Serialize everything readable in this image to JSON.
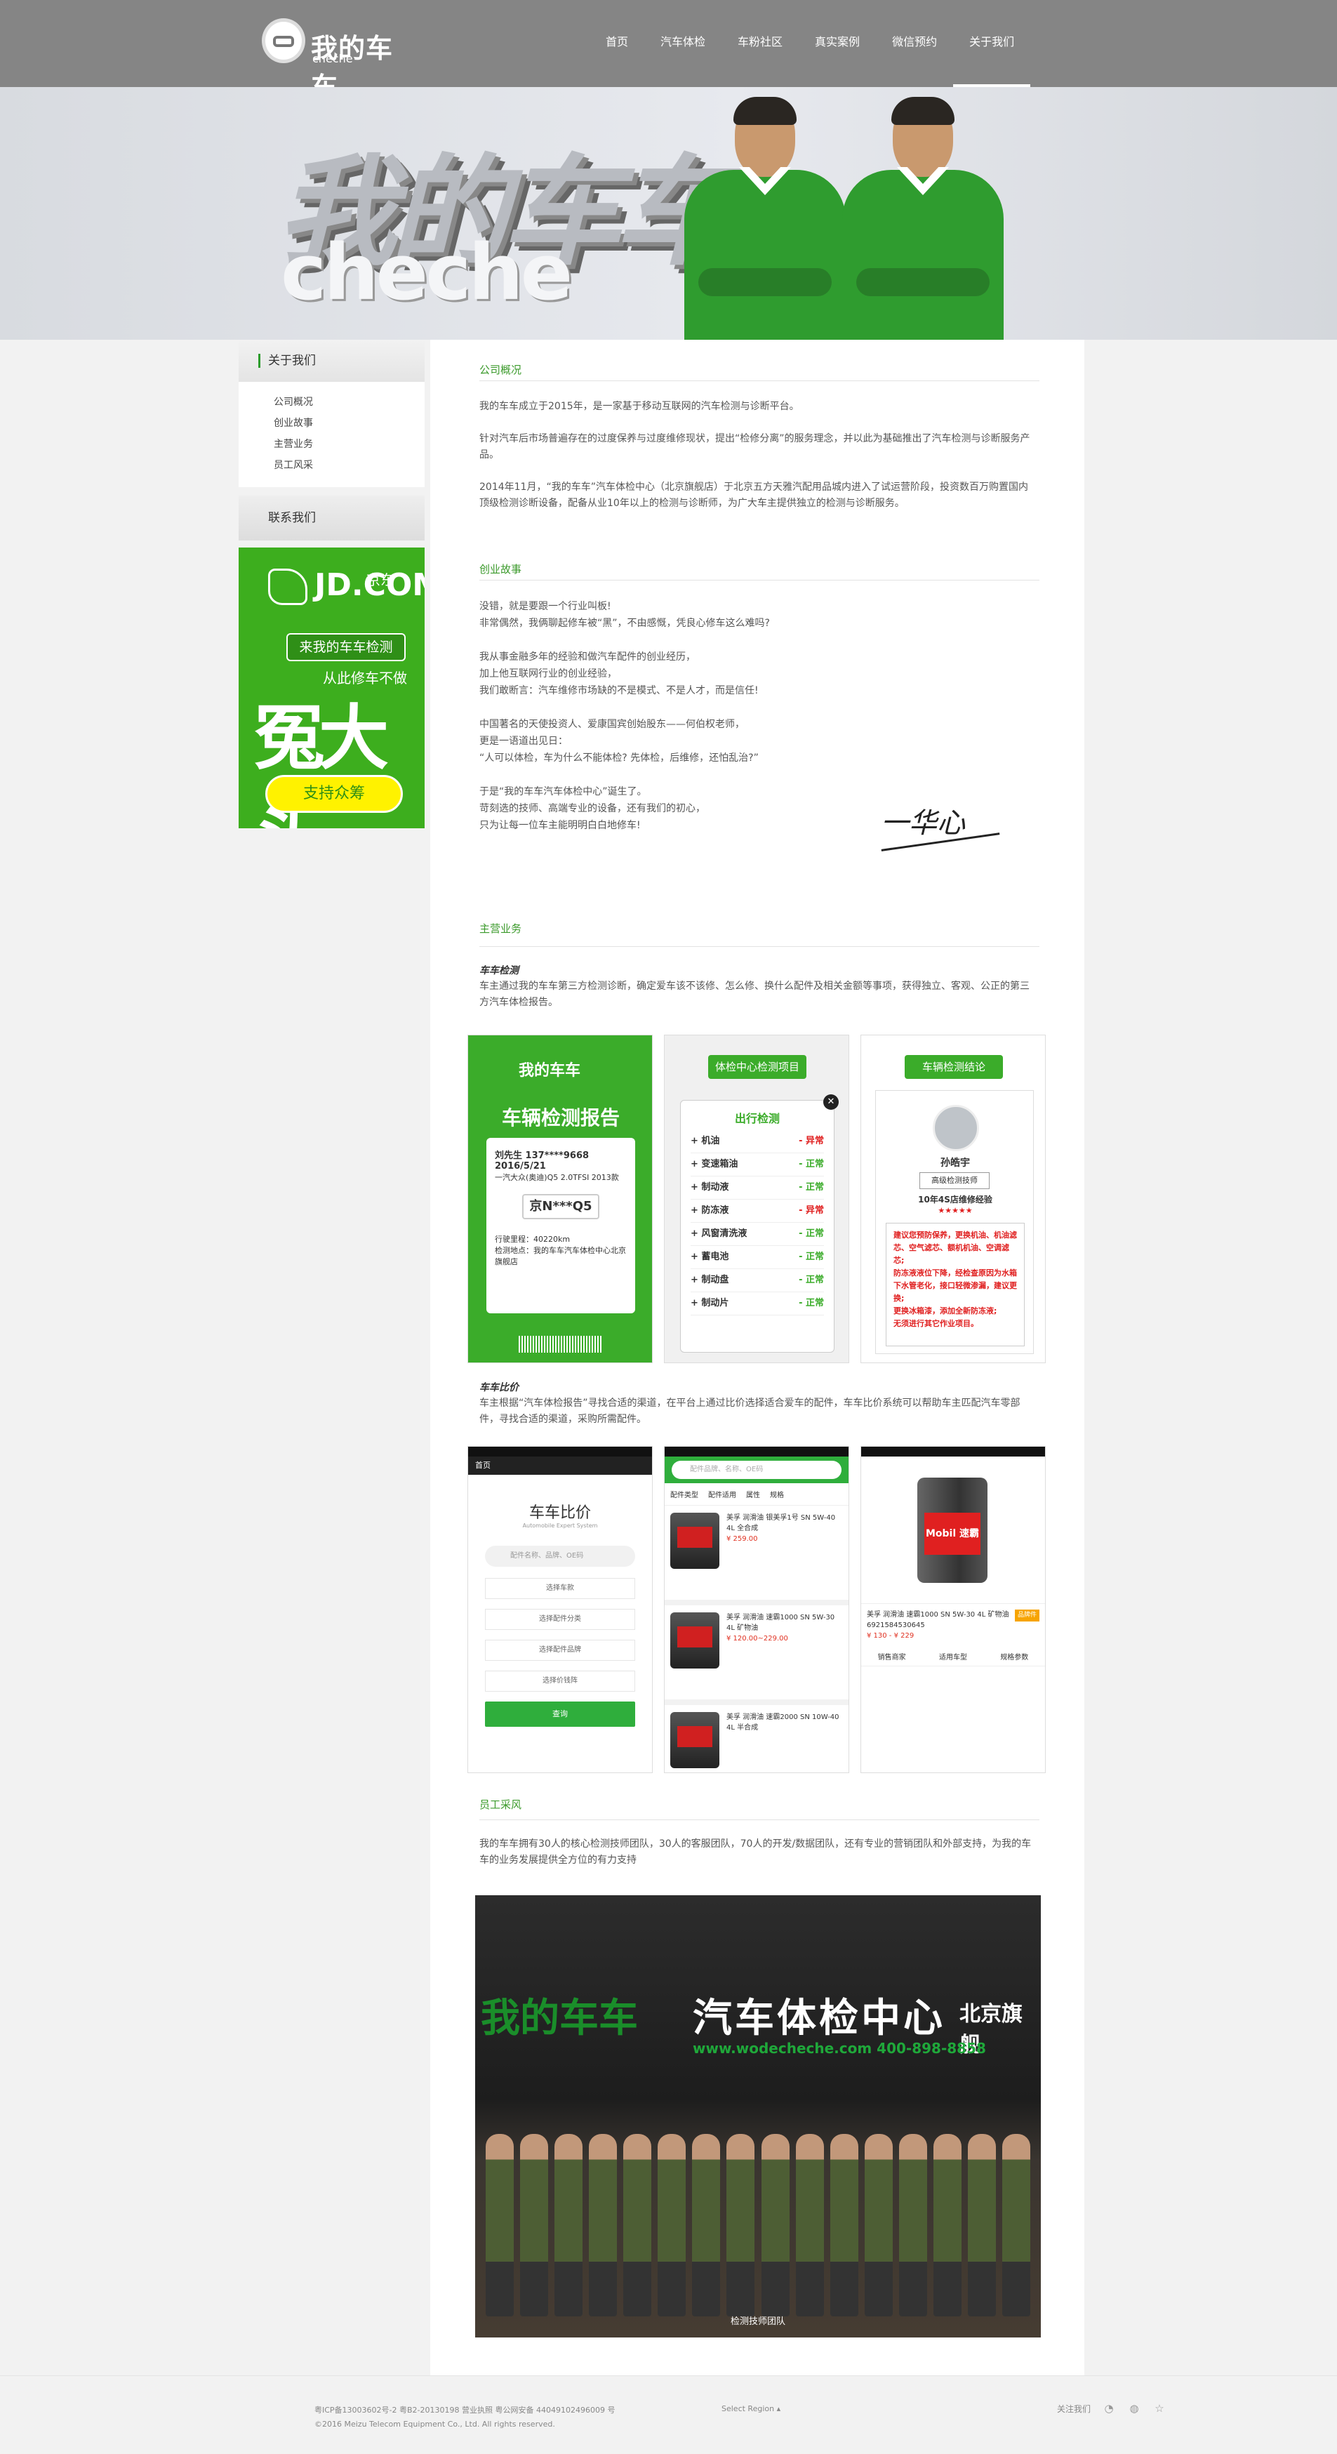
{
  "brand": {
    "cn": "我的车车",
    "en": "cheche"
  },
  "nav": [
    "首页",
    "汽车体检",
    "车粉社区",
    "真实案例",
    "微信预约",
    "关于我们"
  ],
  "banner": {
    "text3d": "我的车车",
    "text_en": "cheche"
  },
  "sidebar": {
    "title": "关于我们",
    "links": [
      "公司概况",
      "创业故事",
      "主营业务",
      "员工风采"
    ],
    "contact": "联系我们"
  },
  "jd_ad": {
    "logo": "JD.COM",
    "logo_cn": "京东",
    "bubble": "来我的车车检测",
    "sub": "从此修车不做",
    "big": "冤大头",
    "button": "支持众筹"
  },
  "overview": {
    "title": "公司概况",
    "paras": [
      "我的车车成立于2015年，是一家基于移动互联网的汽车检测与诊断平台。",
      "针对汽车后市场普遍存在的过度保养与过度维修现状，提出“检修分离”的服务理念，并以此为基础推出了汽车检测与诊断服务产品。",
      "2014年11月，“我的车车”汽车体检中心（北京旗舰店）于北京五方天雅汽配用品城内进入了试运营阶段，投资数百万购置国内顶级检测诊断设备，配备从业10年以上的检测与诊断师，为广大车主提供独立的检测与诊断服务。"
    ]
  },
  "story": {
    "title": "创业故事",
    "paras": [
      [
        "没错，就是要跟一个行业叫板!",
        "非常偶然，我俩聊起修车被“黑”，不由感慨，凭良心修车这么难吗?"
      ],
      [
        "我从事金融多年的经验和做汽车配件的创业经历，",
        "加上他互联网行业的创业经验，",
        "我们敢断言：汽车维修市场缺的不是模式、不是人才，而是信任!"
      ],
      [
        "中国著名的天使投资人、爱康国宾创始股东——何伯权老师，",
        "更是一语道出见日：",
        "“人可以体检，车为什么不能体检? 先体检，后维修，还怕乱治?”"
      ],
      [
        "于是“我的车车汽车体检中心”诞生了。",
        "苛刻选的技师、高端专业的设备，还有我们的初心，",
        "只为让每一位车主能明明白白地修车!"
      ]
    ],
    "signature": "一华心"
  },
  "business": {
    "title": "主营业务",
    "check_label": "车车检测",
    "check_text": "车主通过我的车车第三方检测诊断，确定爱车该不该修、怎么修、换什么配件及相关金额等事项，获得独立、客观、公正的第三方汽车体检报告。",
    "compare_label": "车车比价",
    "compare_text": "车主根据“汽车体检报告”寻找合适的渠道，在平台上通过比价选择适合爱车的配件，车车比价系统可以帮助车主匹配汽车零部件，寻找合适的渠道，采购所需配件。"
  },
  "card1": {
    "logo": "我的车车",
    "title": "车辆检测报告",
    "line1": "刘先生 137****9668 2016/5/21",
    "line2": "一汽大众(奥迪)Q5 2.0TFSI 2013款",
    "plate": "京N***Q5",
    "mile": "行驶里程：40220km",
    "place": "检测地点：我的车车汽车体检中心北京旗舰店"
  },
  "card2": {
    "tag": "体检中心检测项目",
    "heading": "出行检测",
    "items": [
      [
        "机油",
        "- 异常",
        "bad"
      ],
      [
        "变速箱油",
        "- 正常",
        "ok"
      ],
      [
        "制动液",
        "- 正常",
        "ok"
      ],
      [
        "防冻液",
        "- 异常",
        "bad"
      ],
      [
        "风窗清洗液",
        "- 正常",
        "ok"
      ],
      [
        "蓄电池",
        "- 正常",
        "ok"
      ],
      [
        "制动盘",
        "- 正常",
        "ok"
      ],
      [
        "制动片",
        "- 正常",
        "ok"
      ]
    ]
  },
  "card3": {
    "tag": "车辆检测结论",
    "name": "孙皓宇",
    "badge": "高级检测技师",
    "exp": "10年4S店维修经验",
    "stars": "★★★★★",
    "notes": [
      "建议您预防保养，更换机油、机油滤芯、空气滤芯、额机机油、空调滤芯;",
      "防冻液液位下降，经检查原因为水箱下水管老化，接口轻微渗漏，建议更换;",
      "更换冰箱漆，添加全新防冻液;",
      "无须进行其它作业项目。"
    ]
  },
  "phone1": {
    "bar": "首页",
    "logo": "车车比价",
    "sub": "Automobile Expert System",
    "search": "配件名称、品牌、OE码",
    "btns": [
      "选择车款",
      "选择配件分类",
      "选择配件品牌",
      "选择价钱阵"
    ],
    "go": "查询"
  },
  "phone2": {
    "search": "配件品牌、名称、OE码",
    "tabs": [
      "配件类型",
      "配件适用",
      "属性",
      "规格"
    ],
    "items": [
      {
        "name": "美孚 润滑油 银美孚1号 SN 5W-40 4L 全合成",
        "price": "¥ 259.00"
      },
      {
        "name": "美孚 润滑油 速霸1000 SN 5W-30 4L 矿物油",
        "price": "¥ 120.00~229.00"
      },
      {
        "name": "美孚 润滑油 速霸2000 SN 10W-40 4L 半合成",
        "price": ""
      }
    ]
  },
  "phone3": {
    "brand": "Mobil 速霸",
    "name": "美孚 润滑油 速霸1000 SN 5W-30 4L 矿物油",
    "code": "6921584530645",
    "price": "¥ 130 - ¥ 229",
    "tag": "品牌件",
    "tabs": [
      "销售商家",
      "适用车型",
      "规格参数"
    ]
  },
  "staff": {
    "title": "员工采风",
    "text": "我的车车拥有30人的核心检测技师团队，30人的客服团队，70人的开发/数据团队，还有专业的营销团队和外部支持，为我的车车的业务发展提供全方位的有力支持",
    "sign_cn": "我的车车",
    "sign_main": "汽车体检中心",
    "sign_city": "北京旗舰",
    "sign_url": "www.wodecheche.com  400-898-8858",
    "caption": "检测技师团队"
  },
  "footer": {
    "icp": "粤ICP备13003602号-2 粤B2-20130198 营业执照  粤公网安备 44049102496009 号",
    "copy": "©2016 Meizu Telecom Equipment Co., Ltd. All rights reserved.",
    "region": "Select Region",
    "follow": "关注我们"
  }
}
